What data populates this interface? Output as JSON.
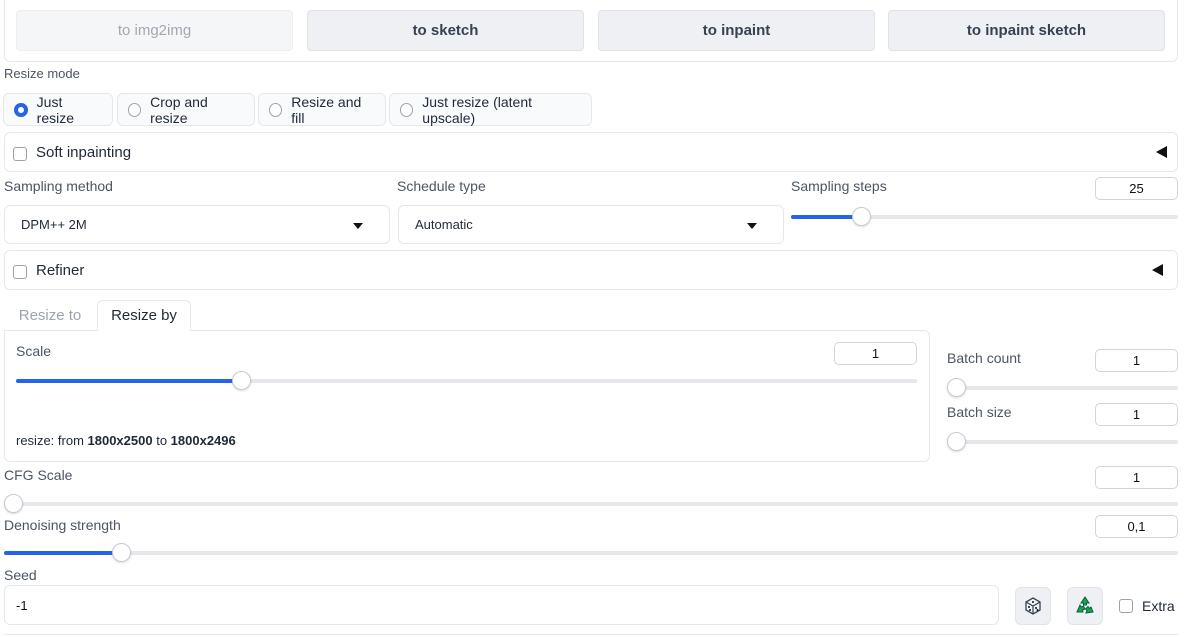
{
  "actions": [
    {
      "label": "to img2img",
      "disabled": true
    },
    {
      "label": "to sketch",
      "disabled": false
    },
    {
      "label": "to inpaint",
      "disabled": false
    },
    {
      "label": "to inpaint sketch",
      "disabled": false
    }
  ],
  "resize_mode": {
    "label": "Resize mode",
    "options": [
      "Just resize",
      "Crop and resize",
      "Resize and fill",
      "Just resize (latent upscale)"
    ],
    "selected": "Just resize"
  },
  "soft_inpainting": {
    "label": "Soft inpainting",
    "checked": false
  },
  "sampling": {
    "method_label": "Sampling method",
    "method_value": "DPM++ 2M",
    "schedule_label": "Schedule type",
    "schedule_value": "Automatic",
    "steps_label": "Sampling steps",
    "steps_value": "25",
    "steps_fraction": 0.18
  },
  "refiner": {
    "label": "Refiner",
    "checked": false
  },
  "size_tabs": {
    "tabs": [
      "Resize to",
      "Resize by"
    ],
    "active": "Resize by"
  },
  "scale": {
    "label": "Scale",
    "value": "1",
    "fraction": 0.25,
    "info_prefix": "resize: from ",
    "from": "1800x2500",
    "info_mid": " to ",
    "to": "1800x2496"
  },
  "batch_count": {
    "label": "Batch count",
    "value": "1",
    "fraction": 0.0
  },
  "batch_size": {
    "label": "Batch size",
    "value": "1",
    "fraction": 0.0
  },
  "cfg": {
    "label": "CFG Scale",
    "value": "1",
    "fraction": 0.0
  },
  "denoising": {
    "label": "Denoising strength",
    "value": "0,1",
    "fraction": 0.1
  },
  "seed": {
    "label": "Seed",
    "value": "-1",
    "extra_label": "Extra",
    "extra_checked": false,
    "icons": [
      "dice-icon",
      "recycle-icon"
    ]
  },
  "colors": {
    "accent": "#2563eb",
    "border": "#e5e7eb",
    "button_bg": "#eef0f3"
  }
}
